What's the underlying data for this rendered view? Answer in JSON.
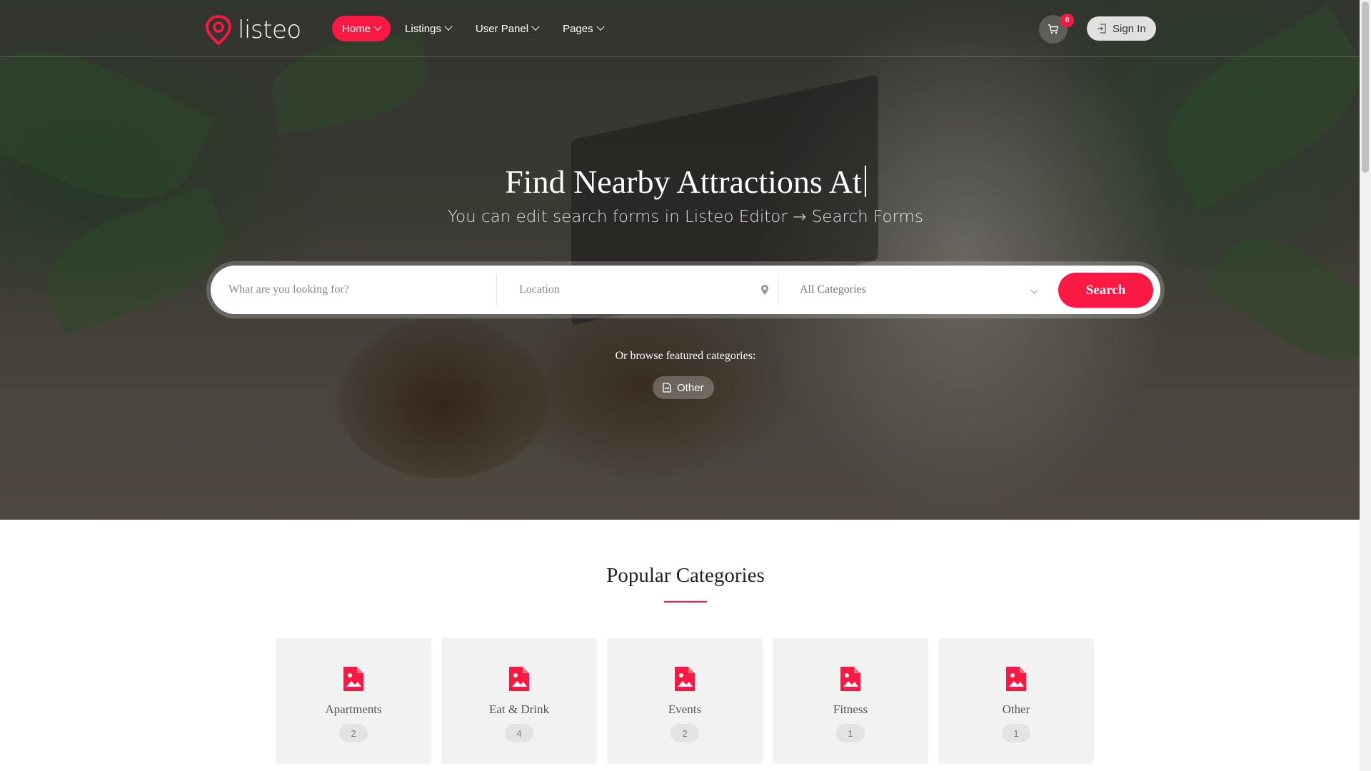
{
  "brand": {
    "name": "listeo",
    "accent_color": "#f91942"
  },
  "nav": {
    "items": [
      {
        "label": "Home",
        "active": true
      },
      {
        "label": "Listings",
        "active": false
      },
      {
        "label": "User Panel",
        "active": false
      },
      {
        "label": "Pages",
        "active": false
      }
    ]
  },
  "header": {
    "cart_count": "0",
    "signin_label": "Sign In",
    "cart_icon": "cart-icon",
    "signin_icon": "login-icon"
  },
  "hero": {
    "title": "Find Nearby Attractions At",
    "subtitle": "You can edit search forms in Listeo Editor → Search Forms"
  },
  "search": {
    "keyword_placeholder": "What are you looking for?",
    "location_placeholder": "Location",
    "category_selected": "All Categories",
    "button_label": "Search"
  },
  "featured": {
    "label": "Or browse featured categories:",
    "chips": [
      {
        "label": "Other",
        "icon": "document-icon"
      }
    ]
  },
  "popular": {
    "title": "Popular Categories",
    "categories": [
      {
        "label": "Apartments",
        "count": "2",
        "icon": "image-file-icon"
      },
      {
        "label": "Eat & Drink",
        "count": "4",
        "icon": "image-file-icon"
      },
      {
        "label": "Events",
        "count": "2",
        "icon": "image-file-icon"
      },
      {
        "label": "Fitness",
        "count": "1",
        "icon": "image-file-icon"
      },
      {
        "label": "Other",
        "count": "1",
        "icon": "image-file-icon"
      }
    ]
  }
}
